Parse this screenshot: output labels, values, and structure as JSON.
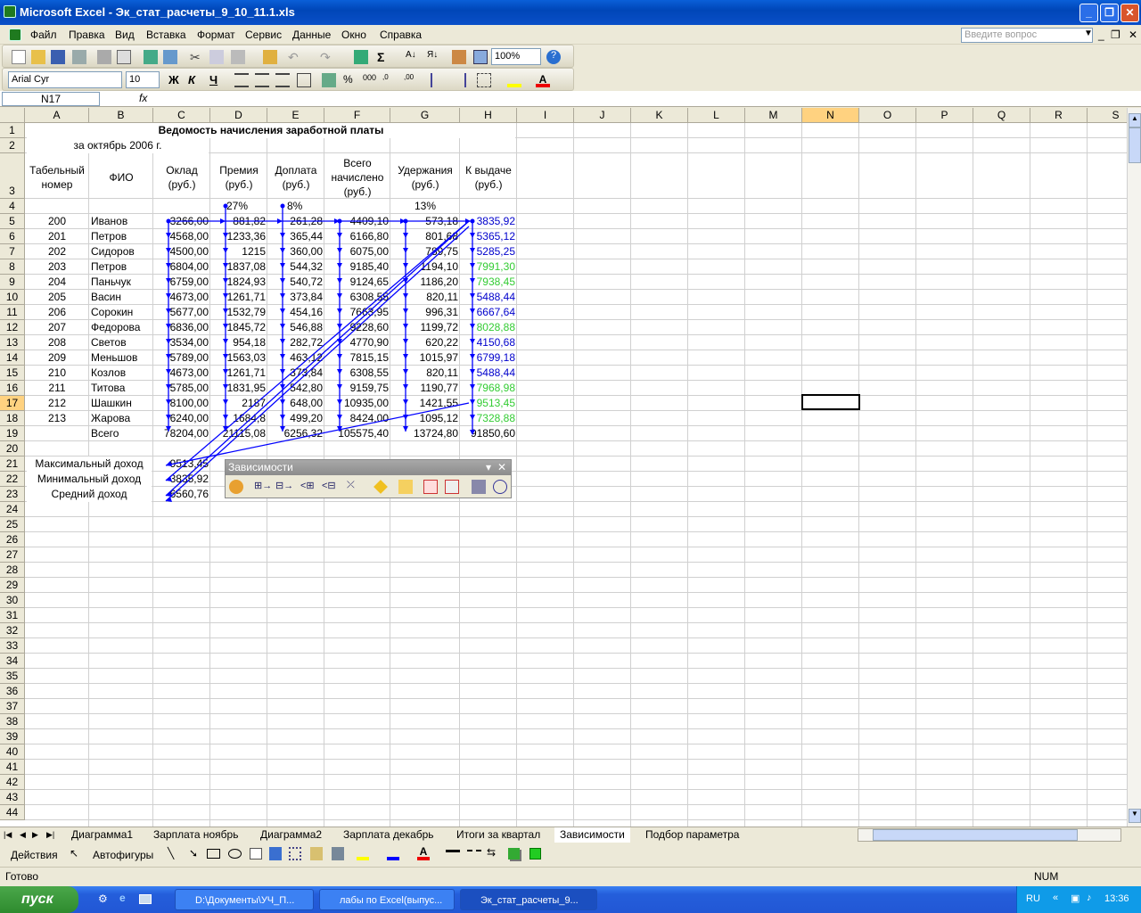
{
  "window": {
    "title": "Microsoft Excel - Эк_стат_расчеты_9_10_11.1.xls"
  },
  "menu": [
    "Файл",
    "Правка",
    "Вид",
    "Вставка",
    "Формат",
    "Сервис",
    "Данные",
    "Окно",
    "Справка"
  ],
  "help_placeholder": "Введите вопрос",
  "toolbar": {
    "zoom": "100%",
    "font": "Arial Cyr",
    "size": "10",
    "bold": "Ж",
    "italic": "К",
    "underline": "Ч"
  },
  "namebox": "N17",
  "fx": "fx",
  "columns": [
    "A",
    "B",
    "C",
    "D",
    "E",
    "F",
    "G",
    "H",
    "I",
    "J",
    "K",
    "L",
    "M",
    "N",
    "O",
    "P",
    "Q",
    "R",
    "S"
  ],
  "sheet": {
    "title": "Ведомость начисления заработной платы",
    "subtitle": "за октябрь 2006 г.",
    "headers": [
      "Табельный номер",
      "ФИО",
      "Оклад (руб.)",
      "Премия (руб.)",
      "Доплата (руб.)",
      "Всего начислено (руб.)",
      "Удержания (руб.)",
      "К выдаче (руб.)"
    ],
    "rates": [
      "27%",
      "8%",
      "13%"
    ],
    "rows": [
      [
        "200",
        "Иванов",
        "3266,00",
        "881,82",
        "261,28",
        "4409,10",
        "573,18",
        "3835,92"
      ],
      [
        "201",
        "Петров",
        "4568,00",
        "1233,36",
        "365,44",
        "6166,80",
        "801,68",
        "5365,12"
      ],
      [
        "202",
        "Сидоров",
        "4500,00",
        "1215",
        "360,00",
        "6075,00",
        "789,75",
        "5285,25"
      ],
      [
        "203",
        "Петров",
        "6804,00",
        "1837,08",
        "544,32",
        "9185,40",
        "1194,10",
        "7991,30"
      ],
      [
        "204",
        "Паньчук",
        "6759,00",
        "1824,93",
        "540,72",
        "9124,65",
        "1186,20",
        "7938,45"
      ],
      [
        "205",
        "Васин",
        "4673,00",
        "1261,71",
        "373,84",
        "6308,55",
        "820,11",
        "5488,44"
      ],
      [
        "206",
        "Сорокин",
        "5677,00",
        "1532,79",
        "454,16",
        "7663,95",
        "996,31",
        "6667,64"
      ],
      [
        "207",
        "Федорова",
        "6836,00",
        "1845,72",
        "546,88",
        "9228,60",
        "1199,72",
        "8028,88"
      ],
      [
        "208",
        "Светов",
        "3534,00",
        "954,18",
        "282,72",
        "4770,90",
        "620,22",
        "4150,68"
      ],
      [
        "209",
        "Меньшов",
        "5789,00",
        "1563,03",
        "463,12",
        "7815,15",
        "1015,97",
        "6799,18"
      ],
      [
        "210",
        "Козлов",
        "4673,00",
        "1261,71",
        "373,84",
        "6308,55",
        "820,11",
        "5488,44"
      ],
      [
        "211",
        "Титова",
        "5785,00",
        "1831,95",
        "542,80",
        "9159,75",
        "1190,77",
        "7968,98"
      ],
      [
        "212",
        "Шашкин",
        "8100,00",
        "2187",
        "648,00",
        "10935,00",
        "1421,55",
        "9513,45"
      ],
      [
        "213",
        "Жарова",
        "6240,00",
        "1684,8",
        "499,20",
        "8424,00",
        "1095,12",
        "7328,88"
      ]
    ],
    "row_colors": [
      "#0000cc",
      "#0000cc",
      "#0000cc",
      "#33cc33",
      "#33cc33",
      "#0000cc",
      "#0000cc",
      "#33cc33",
      "#0000cc",
      "#0000cc",
      "#0000cc",
      "#33cc33",
      "#33cc33",
      "#33cc33"
    ],
    "total": {
      "label": "Всего",
      "values": [
        "78204,00",
        "21115,08",
        "6256,32",
        "105575,40",
        "13724,80",
        "91850,60"
      ]
    },
    "stats": [
      [
        "Максимальный доход",
        "9513,45"
      ],
      [
        "Минимальный доход",
        "3835,92"
      ],
      [
        "Средний доход",
        "6560,76"
      ]
    ]
  },
  "dep_toolbar": {
    "title": "Зависимости"
  },
  "tabs": [
    "Диаграмма1",
    "Зарплата ноябрь",
    "Диаграмма2",
    "Зарплата декабрь",
    "Итоги за квартал",
    "Зависимости",
    "Подбор параметра"
  ],
  "active_tab": "Зависимости",
  "draw": {
    "actions": "Действия",
    "autoshapes": "Автофигуры"
  },
  "status": {
    "left": "Готово",
    "num": "NUM"
  },
  "taskbar": {
    "start": "пуск",
    "tasks": [
      "D:\\Документы\\УЧ_П...",
      "лабы по Excel(выпус...",
      "Эк_стат_расчеты_9..."
    ],
    "lang": "RU",
    "time": "13:36"
  }
}
